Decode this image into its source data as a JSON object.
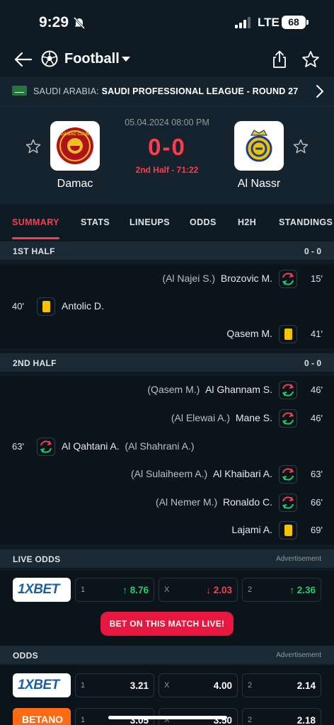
{
  "status": {
    "time": "9:29",
    "network": "LTE",
    "battery": "68"
  },
  "header": {
    "sport": "Football"
  },
  "league": {
    "country": "SAUDI ARABIA:",
    "name": "SAUDI PROFESSIONAL LEAGUE - ROUND 27"
  },
  "match": {
    "date": "05.04.2024 08:00 PM",
    "score": "0-0",
    "status": "2nd Half - 71:22",
    "home": {
      "name": "Damac",
      "logo_text": "DAMAC CLUB"
    },
    "away": {
      "name": "Al Nassr",
      "logo_text": "AL NASSR"
    }
  },
  "tabs": [
    "SUMMARY",
    "STATS",
    "LINEUPS",
    "ODDS",
    "H2H",
    "STANDINGS"
  ],
  "first_half": {
    "title": "1ST HALF",
    "score": "0 - 0",
    "events": [
      {
        "minute": "15'",
        "player": "Brozovic M.",
        "assist": "(Al Najei S.)"
      },
      {
        "minute": "40'",
        "player": "Antolic D."
      },
      {
        "minute": "41'",
        "player": "Qasem M."
      }
    ]
  },
  "second_half": {
    "title": "2ND HALF",
    "score": "0 - 0",
    "events": [
      {
        "minute": "46'",
        "player": "Al Ghannam S.",
        "assist": "(Qasem M.)"
      },
      {
        "minute": "46'",
        "player": "Mane S.",
        "assist": "(Al Elewai A.)"
      },
      {
        "minute": "63'",
        "player": "Al Qahtani A.",
        "assist": "(Al Shahrani A.)"
      },
      {
        "minute": "63'",
        "player": "Al Khaibari A.",
        "assist": "(Al Sulaiheem A.)"
      },
      {
        "minute": "66'",
        "player": "Ronaldo C.",
        "assist": "(Al Nemer M.)"
      },
      {
        "minute": "69'",
        "player": "Lajami A."
      }
    ]
  },
  "live_odds": {
    "title": "LIVE ODDS",
    "ad": "Advertisement",
    "bookmaker": "1XBET",
    "odds": [
      {
        "label": "1",
        "value": "8.76",
        "trend": "up"
      },
      {
        "label": "X",
        "value": "2.03",
        "trend": "down"
      },
      {
        "label": "2",
        "value": "2.36",
        "trend": "up"
      }
    ],
    "cta": "BET ON THIS MATCH LIVE!"
  },
  "odds": {
    "title": "ODDS",
    "ad": "Advertisement",
    "rows": [
      {
        "bookmaker": "1XBET",
        "odds": [
          {
            "label": "1",
            "value": "3.21"
          },
          {
            "label": "X",
            "value": "4.00"
          },
          {
            "label": "2",
            "value": "2.14"
          }
        ]
      },
      {
        "bookmaker": "BETANO",
        "odds": [
          {
            "label": "1",
            "value": "3.05"
          },
          {
            "label": "X",
            "value": "3.50"
          },
          {
            "label": "2",
            "value": "2.18"
          }
        ]
      }
    ]
  },
  "colors": {
    "accent": "#ff3b4f",
    "up": "#1fcf6b",
    "down": "#ff3b4f",
    "card": "#f5c400"
  }
}
